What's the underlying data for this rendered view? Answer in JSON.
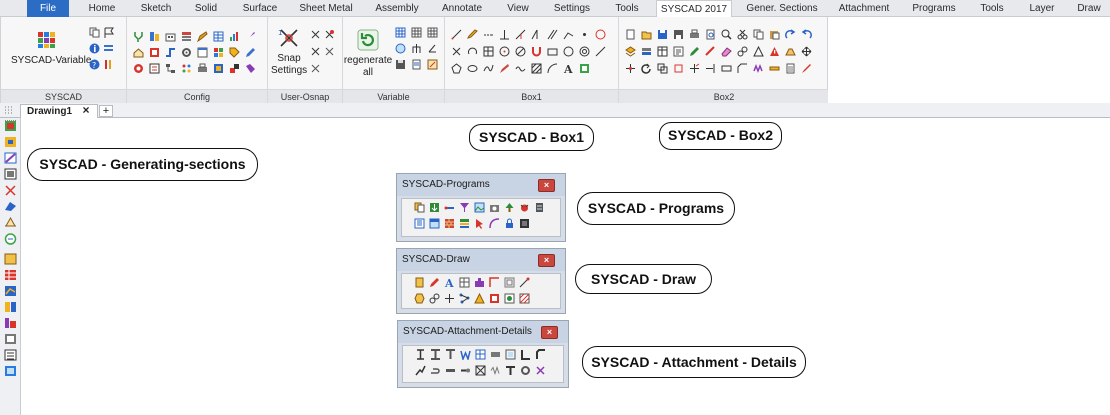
{
  "menu_tabs": [
    "File",
    "Home",
    "Sketch",
    "Solid",
    "Surface",
    "Sheet Metal",
    "Assembly",
    "Annotate",
    "View",
    "Settings",
    "Tools",
    "SYSCAD 2017",
    "Gener. Sections",
    "Attachment",
    "Programs",
    "Tools",
    "Layer",
    "Draw"
  ],
  "active_tab": "SYSCAD 2017",
  "ribbon": {
    "syscad_group_label": "SYSCAD",
    "syscad_variable_label": "SYSCAD-Variable",
    "config_label": "Config",
    "user_osnap_label": "User-Osnap",
    "snap_settings_label": "Snap Settings",
    "variable_label": "Variable",
    "regenerate_all_label": "regenerate all",
    "box1_label": "Box1",
    "box2_label": "Box2"
  },
  "document_tab": {
    "title": "Drawing1",
    "close_glyph": "×",
    "add_glyph": "+"
  },
  "callouts": {
    "box1": "SYSCAD - Box1",
    "box2": "SYSCAD - Box2",
    "generating_sections": "SYSCAD - Generating-sections",
    "programs": "SYSCAD - Programs",
    "draw": "SYSCAD - Draw",
    "attachment_details": "SYSCAD - Attachment - Details"
  },
  "floating_toolbars": {
    "programs_title": "SYSCAD-Programs",
    "draw_title": "SYSCAD-Draw",
    "attachment_title": "SYSCAD-Attachment-Details",
    "close_glyph": "×"
  },
  "colors": {
    "file_tab": "#2b6cc4",
    "ribbon_bg": "#f7f7f7",
    "float_title": "#c8d4e4",
    "close_red": "#c9473f"
  }
}
